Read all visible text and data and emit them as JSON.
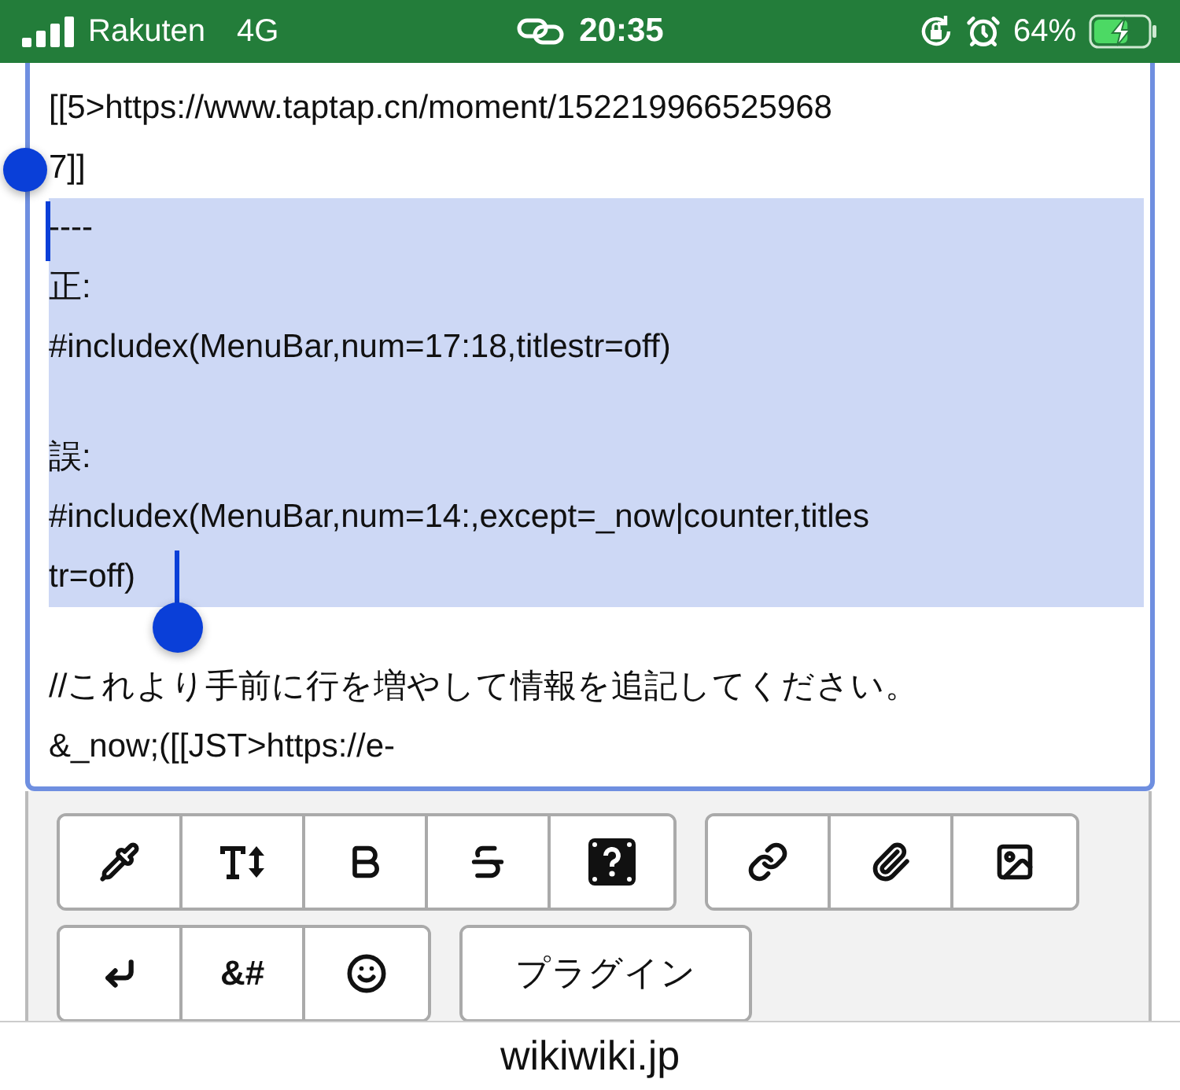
{
  "status_bar": {
    "carrier": "Rakuten",
    "network": "4G",
    "time": "20:35",
    "battery": "64%",
    "charging": true
  },
  "editor": {
    "lines": [
      {
        "text": "[[5>https://www.taptap.cn/moment/152219966525968",
        "selected": false
      },
      {
        "text": "7]]",
        "selected": false
      },
      {
        "text": "----",
        "selected": true
      },
      {
        "text": "正:",
        "selected": true
      },
      {
        "text": "#includex(MenuBar,num=17:18,titlestr=off)",
        "selected": true
      },
      {
        "selected": true
      },
      {
        "text": "誤:",
        "selected": true
      },
      {
        "text": "#includex(MenuBar,num=14:,except=_now|counter,titles",
        "selected": true
      },
      {
        "text": "tr=off)",
        "selected": true
      },
      {
        "selected": false
      },
      {
        "text": "//これより手前に行を増やして情報を追記してください。",
        "selected": false
      },
      {
        "text": "&_now;([[JST>https://e-",
        "selected": false
      }
    ]
  },
  "toolbar": {
    "groups": [
      [
        {
          "kind": "eyedropper"
        },
        {
          "kind": "text-size"
        },
        {
          "kind": "bold"
        },
        {
          "kind": "strike"
        },
        {
          "kind": "question"
        }
      ],
      [
        {
          "kind": "link"
        },
        {
          "kind": "paperclip"
        },
        {
          "kind": "image"
        }
      ],
      [
        {
          "kind": "enter"
        },
        {
          "kind": "text",
          "label": "&#"
        },
        {
          "kind": "smile"
        }
      ],
      [
        {
          "kind": "text",
          "label": "プラグイン"
        }
      ]
    ]
  },
  "footer": {
    "domain": "wikiwiki.jp"
  }
}
